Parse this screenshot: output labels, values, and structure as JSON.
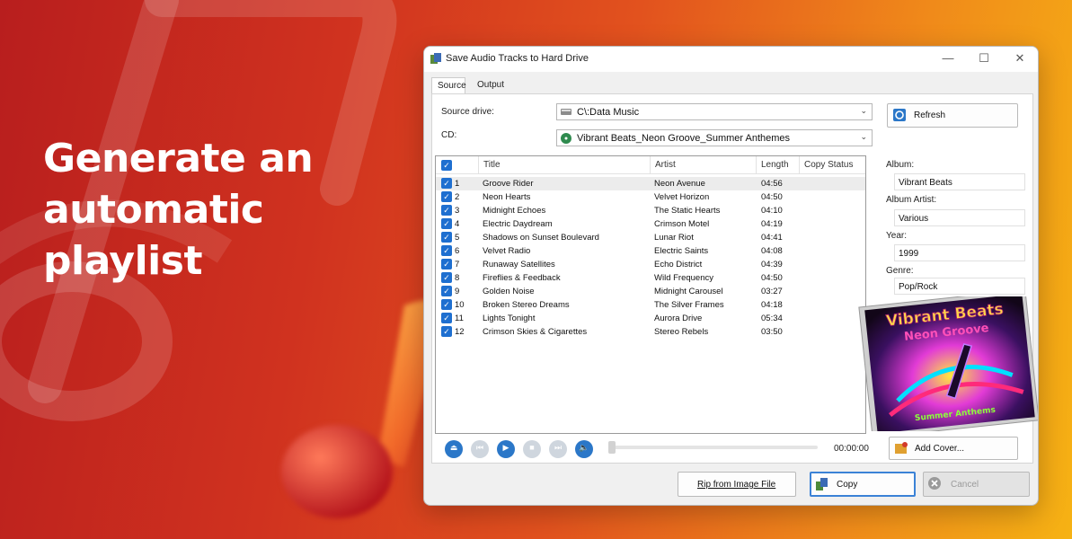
{
  "headline": "Generate an automatic playlist",
  "window": {
    "title": "Save Audio Tracks to Hard Drive",
    "controls": {
      "minimize": "—",
      "maximize": "☐",
      "close": "✕"
    }
  },
  "tabs": [
    "Source",
    "Output"
  ],
  "source": {
    "drive_label": "Source drive:",
    "drive_value": "C\\:Data Music",
    "cd_label": "CD:",
    "cd_value": "Vibrant Beats_Neon Groove_Summer Anthemes",
    "refresh_label": "Refresh"
  },
  "tracklist": {
    "columns": [
      "Title",
      "Artist",
      "Length",
      "Copy Status"
    ],
    "tracks": [
      {
        "n": "1",
        "title": "Groove Rider",
        "artist": "Neon Avenue",
        "length": "04:56"
      },
      {
        "n": "2",
        "title": "Neon Hearts",
        "artist": "Velvet Horizon",
        "length": "04:50"
      },
      {
        "n": "3",
        "title": "Midnight Echoes",
        "artist": "The Static Hearts",
        "length": "04:10"
      },
      {
        "n": "4",
        "title": "Electric Daydream",
        "artist": "Crimson Motel",
        "length": "04:19"
      },
      {
        "n": "5",
        "title": "Shadows on Sunset Boulevard",
        "artist": "Lunar Riot",
        "length": "04:41"
      },
      {
        "n": "6",
        "title": "Velvet Radio",
        "artist": "Electric Saints",
        "length": "04:08"
      },
      {
        "n": "7",
        "title": "Runaway Satellites",
        "artist": "Echo District",
        "length": "04:39"
      },
      {
        "n": "8",
        "title": "Fireflies & Feedback",
        "artist": "Wild Frequency",
        "length": "04:50"
      },
      {
        "n": "9",
        "title": "Golden Noise",
        "artist": "Midnight Carousel",
        "length": "03:27"
      },
      {
        "n": "10",
        "title": "Broken Stereo Dreams",
        "artist": "The Silver Frames",
        "length": "04:18"
      },
      {
        "n": "11",
        "title": "Lights Tonight",
        "artist": "Aurora Drive",
        "length": "05:34"
      },
      {
        "n": "12",
        "title": "Crimson Skies & Cigarettes",
        "artist": "Stereo Rebels",
        "length": "03:50"
      }
    ]
  },
  "player": {
    "time": "00:00:00"
  },
  "album": {
    "album_label": "Album:",
    "album_value": "Vibrant Beats",
    "artist_label": "Album Artist:",
    "artist_value": "Various",
    "year_label": "Year:",
    "year_value": "1999",
    "genre_label": "Genre:",
    "genre_value": "Pop/Rock",
    "add_cover_label": "Add Cover..."
  },
  "cover_art": {
    "line1": "Vibrant Beats",
    "line2": "Neon Groove",
    "line3": "Summer Anthems"
  },
  "buttons": {
    "rip": "Rip from Image File",
    "copy": "Copy",
    "cancel": "Cancel"
  },
  "colors": {
    "accent": "#1e6fd0",
    "bg_start": "#b81e1e",
    "bg_end": "#f6b214"
  }
}
